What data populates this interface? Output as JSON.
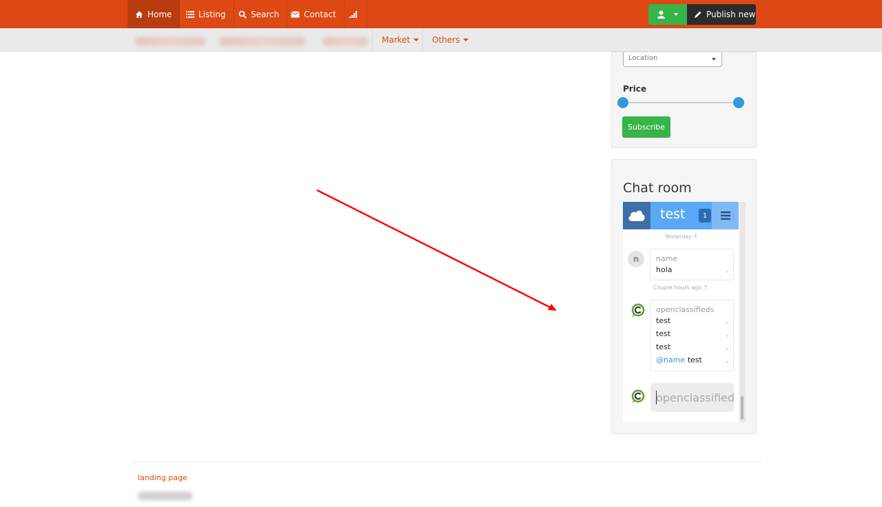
{
  "nav": {
    "home": "Home",
    "listing": "Listing",
    "search": "Search",
    "contact": "Contact",
    "publish": "Publish new"
  },
  "subnav": {
    "market": "Market",
    "others": "Others"
  },
  "sidebar": {
    "location_placeholder": "Location",
    "price_label": "Price",
    "subscribe": "Subscribe"
  },
  "chat": {
    "title": "Chat room",
    "room_name": "test",
    "unread_count": "1",
    "timestamp_1": "Yesterday ↑",
    "avatar_letter": "n",
    "message_1": {
      "author": "name",
      "text": "hola"
    },
    "timestamp_2": "Couple hours ago ↑",
    "message_2": {
      "author": "openclassifieds",
      "lines": [
        "test",
        "test",
        "test"
      ],
      "mention": "@name",
      "mention_text": " test"
    },
    "input_placeholder": "openclassifieds"
  },
  "footer": {
    "link": "landing page"
  },
  "colors": {
    "brand": "#dd4814",
    "green": "#38b44a",
    "chat_blue": "#59a8f5",
    "annotation_red": "#ff0000"
  }
}
